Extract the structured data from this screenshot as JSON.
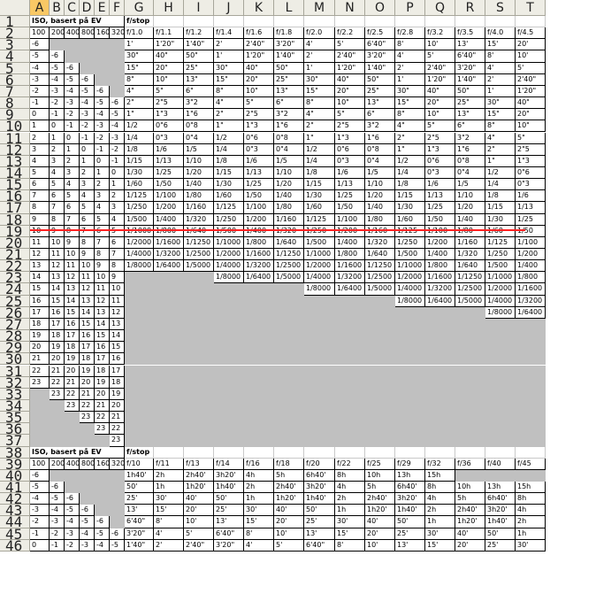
{
  "columns": [
    "A",
    "B",
    "C",
    "D",
    "E",
    "F",
    "G",
    "H",
    "I",
    "J",
    "K",
    "L",
    "M",
    "N",
    "O",
    "P",
    "Q",
    "R",
    "S",
    "T"
  ],
  "selected_column": "A",
  "rows": [
    "1",
    "2",
    "3",
    "4",
    "5",
    "6",
    "7",
    "8",
    "9",
    "10",
    "11",
    "12",
    "13",
    "14",
    "15",
    "16",
    "17",
    "18",
    "19",
    "20",
    "21",
    "22",
    "23",
    "24",
    "25",
    "26",
    "27",
    "28",
    "29",
    "30",
    "31",
    "32",
    "33",
    "34",
    "35",
    "36",
    "37",
    "38",
    "39",
    "40",
    "41",
    "42",
    "43",
    "44",
    "45",
    "46"
  ],
  "top_block": {
    "iso_title": "ISO, basert på EV",
    "fstop_title": "f/stop",
    "iso_values": [
      "100",
      "200",
      "400",
      "800",
      "1600",
      "3200"
    ],
    "fstops": [
      "f/1.0",
      "f/1.1",
      "f/1.2",
      "f/1.4",
      "f/1.6",
      "f/1.8",
      "f/2.0",
      "f/2.2",
      "f/2.5",
      "f/2.8",
      "f/3.2",
      "f/3.5",
      "f/4.0",
      "f/4.5"
    ],
    "ev_rows": [
      [
        "-6",
        "",
        "",
        "",
        "",
        ""
      ],
      [
        "-5",
        "-6",
        "",
        "",
        "",
        ""
      ],
      [
        "-4",
        "-5",
        "-6",
        "",
        "",
        ""
      ],
      [
        "-3",
        "-4",
        "-5",
        "-6",
        "",
        ""
      ],
      [
        "-2",
        "-3",
        "-4",
        "-5",
        "-6",
        ""
      ],
      [
        "-1",
        "-2",
        "-3",
        "-4",
        "-5",
        "-6"
      ],
      [
        "0",
        "-1",
        "-2",
        "-3",
        "-4",
        "-5"
      ],
      [
        "1",
        "0",
        "-1",
        "-2",
        "-3",
        "-4"
      ],
      [
        "2",
        "1",
        "0",
        "-1",
        "-2",
        "-3"
      ],
      [
        "3",
        "2",
        "1",
        "0",
        "-1",
        "-2"
      ],
      [
        "4",
        "3",
        "2",
        "1",
        "0",
        "-1"
      ],
      [
        "5",
        "4",
        "3",
        "2",
        "1",
        "0"
      ],
      [
        "6",
        "5",
        "4",
        "3",
        "2",
        "1"
      ],
      [
        "7",
        "6",
        "5",
        "4",
        "3",
        "2"
      ],
      [
        "8",
        "7",
        "6",
        "5",
        "4",
        "3"
      ],
      [
        "9",
        "8",
        "7",
        "6",
        "5",
        "4"
      ],
      [
        "10",
        "9",
        "8",
        "7",
        "6",
        "5"
      ],
      [
        "11",
        "10",
        "9",
        "8",
        "7",
        "6"
      ],
      [
        "12",
        "11",
        "10",
        "9",
        "8",
        "7"
      ],
      [
        "13",
        "12",
        "11",
        "10",
        "9",
        "8"
      ],
      [
        "14",
        "13",
        "12",
        "11",
        "10",
        "9"
      ],
      [
        "15",
        "14",
        "13",
        "12",
        "11",
        "10"
      ],
      [
        "16",
        "15",
        "14",
        "13",
        "12",
        "11"
      ],
      [
        "17",
        "16",
        "15",
        "14",
        "13",
        "12"
      ],
      [
        "18",
        "17",
        "16",
        "15",
        "14",
        "13"
      ],
      [
        "19",
        "18",
        "17",
        "16",
        "15",
        "14"
      ],
      [
        "20",
        "19",
        "18",
        "17",
        "16",
        "15"
      ],
      [
        "21",
        "20",
        "19",
        "18",
        "17",
        "16"
      ],
      [
        "22",
        "21",
        "20",
        "19",
        "18",
        "17"
      ],
      [
        "23",
        "22",
        "21",
        "20",
        "19",
        "18"
      ],
      [
        "",
        "23",
        "22",
        "21",
        "20",
        "19"
      ],
      [
        "",
        "",
        "23",
        "22",
        "21",
        "20"
      ],
      [
        "",
        "",
        "",
        "23",
        "22",
        "21"
      ],
      [
        "",
        "",
        "",
        "",
        "23",
        "22"
      ],
      [
        "",
        "",
        "",
        "",
        "",
        "23"
      ]
    ],
    "shutter_rows": [
      [
        "1'",
        "1'20\"",
        "1'40\"",
        "2'",
        "2'40\"",
        "3'20\"",
        "4'",
        "5'",
        "6'40\"",
        "8'",
        "10'",
        "13'",
        "15'",
        "20'"
      ],
      [
        "30\"",
        "40\"",
        "50\"",
        "1'",
        "1'20\"",
        "1'40\"",
        "2'",
        "2'40\"",
        "3'20\"",
        "4'",
        "5'",
        "6'40\"",
        "8'",
        "10'"
      ],
      [
        "15\"",
        "20\"",
        "25\"",
        "30\"",
        "40\"",
        "50\"",
        "1'",
        "1'20\"",
        "1'40\"",
        "2'",
        "2'40\"",
        "3'20\"",
        "4'",
        "5'"
      ],
      [
        "8\"",
        "10\"",
        "13\"",
        "15\"",
        "20\"",
        "25\"",
        "30\"",
        "40\"",
        "50\"",
        "1'",
        "1'20\"",
        "1'40\"",
        "2'",
        "2'40\""
      ],
      [
        "4\"",
        "5\"",
        "6\"",
        "8\"",
        "10\"",
        "13\"",
        "15\"",
        "20\"",
        "25\"",
        "30\"",
        "40\"",
        "50\"",
        "1'",
        "1'20\""
      ],
      [
        "2\"",
        "2\"5",
        "3\"2",
        "4\"",
        "5\"",
        "6\"",
        "8\"",
        "10\"",
        "13\"",
        "15\"",
        "20\"",
        "25\"",
        "30\"",
        "40\""
      ],
      [
        "1\"",
        "1\"3",
        "1\"6",
        "2\"",
        "2\"5",
        "3\"2",
        "4\"",
        "5\"",
        "6\"",
        "8\"",
        "10\"",
        "13\"",
        "15\"",
        "20\""
      ],
      [
        "1/2",
        "0\"6",
        "0\"8",
        "1\"",
        "1\"3",
        "1\"6",
        "2\"",
        "2\"5",
        "3\"2",
        "4\"",
        "5\"",
        "6\"",
        "8\"",
        "10\""
      ],
      [
        "1/4",
        "0\"3",
        "0\"4",
        "1/2",
        "0\"6",
        "0\"8",
        "1\"",
        "1\"3",
        "1\"6",
        "2\"",
        "2\"5",
        "3\"2",
        "4\"",
        "5\""
      ],
      [
        "1/8",
        "1/6",
        "1/5",
        "1/4",
        "0\"3",
        "0\"4",
        "1/2",
        "0\"6",
        "0\"8",
        "1\"",
        "1\"3",
        "1\"6",
        "2\"",
        "2\"5"
      ],
      [
        "1/15",
        "1/13",
        "1/10",
        "1/8",
        "1/6",
        "1/5",
        "1/4",
        "0\"3",
        "0\"4",
        "1/2",
        "0\"6",
        "0\"8",
        "1\"",
        "1\"3"
      ],
      [
        "1/30",
        "1/25",
        "1/20",
        "1/15",
        "1/13",
        "1/10",
        "1/8",
        "1/6",
        "1/5",
        "1/4",
        "0\"3",
        "0\"4",
        "1/2",
        "0\"6"
      ],
      [
        "1/60",
        "1/50",
        "1/40",
        "1/30",
        "1/25",
        "1/20",
        "1/15",
        "1/13",
        "1/10",
        "1/8",
        "1/6",
        "1/5",
        "1/4",
        "0\"3"
      ],
      [
        "1/125",
        "1/100",
        "1/80",
        "1/60",
        "1/50",
        "1/40",
        "1/30",
        "1/25",
        "1/20",
        "1/15",
        "1/13",
        "1/10",
        "1/8",
        "1/6"
      ],
      [
        "1/250",
        "1/200",
        "1/160",
        "1/125",
        "1/100",
        "1/80",
        "1/60",
        "1/50",
        "1/40",
        "1/30",
        "1/25",
        "1/20",
        "1/15",
        "1/13"
      ],
      [
        "1/500",
        "1/400",
        "1/320",
        "1/250",
        "1/200",
        "1/160",
        "1/125",
        "1/100",
        "1/80",
        "1/60",
        "1/50",
        "1/40",
        "1/30",
        "1/25"
      ],
      [
        "1/1000",
        "1/800",
        "1/640",
        "1/500",
        "1/400",
        "1/320",
        "1/250",
        "1/200",
        "1/160",
        "1/125",
        "1/100",
        "1/80",
        "1/60",
        "1/50"
      ],
      [
        "1/2000",
        "1/1600",
        "1/1250",
        "1/1000",
        "1/800",
        "1/640",
        "1/500",
        "1/400",
        "1/320",
        "1/250",
        "1/200",
        "1/160",
        "1/125",
        "1/100"
      ],
      [
        "1/4000",
        "1/3200",
        "1/2500",
        "1/2000",
        "1/1600",
        "1/1250",
        "1/1000",
        "1/800",
        "1/640",
        "1/500",
        "1/400",
        "1/320",
        "1/250",
        "1/200"
      ],
      [
        "1/8000",
        "1/6400",
        "1/5000",
        "1/4000",
        "1/3200",
        "1/2500",
        "1/2000",
        "1/1600",
        "1/1250",
        "1/1000",
        "1/800",
        "1/640",
        "1/500",
        "1/400"
      ],
      [
        "",
        "",
        "",
        "1/8000",
        "1/6400",
        "1/5000",
        "1/4000",
        "1/3200",
        "1/2500",
        "1/2000",
        "1/1600",
        "1/1250",
        "1/1000",
        "1/800"
      ],
      [
        "",
        "",
        "",
        "",
        "",
        "",
        "1/8000",
        "1/6400",
        "1/5000",
        "1/4000",
        "1/3200",
        "1/2500",
        "1/2000",
        "1/1600"
      ],
      [
        "",
        "",
        "",
        "",
        "",
        "",
        "",
        "",
        "",
        "1/8000",
        "1/6400",
        "1/5000",
        "1/4000",
        "1/3200"
      ],
      [
        "",
        "",
        "",
        "",
        "",
        "",
        "",
        "",
        "",
        "",
        "",
        "",
        "1/8000",
        "1/6400"
      ]
    ]
  },
  "bottom_block": {
    "iso_title": "ISO, basert på EV",
    "fstop_title": "f/stop",
    "iso_values": [
      "100",
      "200",
      "400",
      "800",
      "1600",
      "3200"
    ],
    "fstops": [
      "f/10",
      "f/11",
      "f/13",
      "f/14",
      "f/16",
      "f/18",
      "f/20",
      "f/22",
      "f/25",
      "f/29",
      "f/32",
      "f/36",
      "f/40",
      "f/45"
    ],
    "ev_rows": [
      [
        "-6",
        "",
        "",
        "",
        "",
        ""
      ],
      [
        "-5",
        "-6",
        "",
        "",
        "",
        ""
      ],
      [
        "-4",
        "-5",
        "-6",
        "",
        "",
        ""
      ],
      [
        "-3",
        "-4",
        "-5",
        "-6",
        "",
        ""
      ],
      [
        "-2",
        "-3",
        "-4",
        "-5",
        "-6",
        ""
      ],
      [
        "-1",
        "-2",
        "-3",
        "-4",
        "-5",
        "-6"
      ],
      [
        "0",
        "-1",
        "-2",
        "-3",
        "-4",
        "-5"
      ]
    ],
    "shutter_rows": [
      [
        "1h40'",
        "2h",
        "2h40'",
        "3h20'",
        "4h",
        "5h",
        "6h40'",
        "8h",
        "10h",
        "13h",
        "15h",
        "",
        "",
        ""
      ],
      [
        "50'",
        "1h",
        "1h20'",
        "1h40'",
        "2h",
        "2h40'",
        "3h20'",
        "4h",
        "5h",
        "6h40'",
        "8h",
        "10h",
        "13h",
        "15h"
      ],
      [
        "25'",
        "30'",
        "40'",
        "50'",
        "1h",
        "1h20'",
        "1h40'",
        "2h",
        "2h40'",
        "3h20'",
        "4h",
        "5h",
        "6h40'",
        "8h"
      ],
      [
        "13'",
        "15'",
        "20'",
        "25'",
        "30'",
        "40'",
        "50'",
        "1h",
        "1h20'",
        "1h40'",
        "2h",
        "2h40'",
        "3h20'",
        "4h"
      ],
      [
        "6'40\"",
        "8'",
        "10'",
        "13'",
        "15'",
        "20'",
        "25'",
        "30'",
        "40'",
        "50'",
        "1h",
        "1h20'",
        "1h40'",
        "2h"
      ],
      [
        "3'20\"",
        "4'",
        "5'",
        "6'40\"",
        "8'",
        "10'",
        "13'",
        "15'",
        "20'",
        "25'",
        "30'",
        "40'",
        "50'",
        "1h"
      ],
      [
        "1'40\"",
        "2'",
        "2'40\"",
        "3'20\"",
        "4'",
        "5'",
        "6'40\"",
        "8'",
        "10'",
        "13'",
        "15'",
        "20'",
        "25'",
        "30'"
      ]
    ]
  }
}
